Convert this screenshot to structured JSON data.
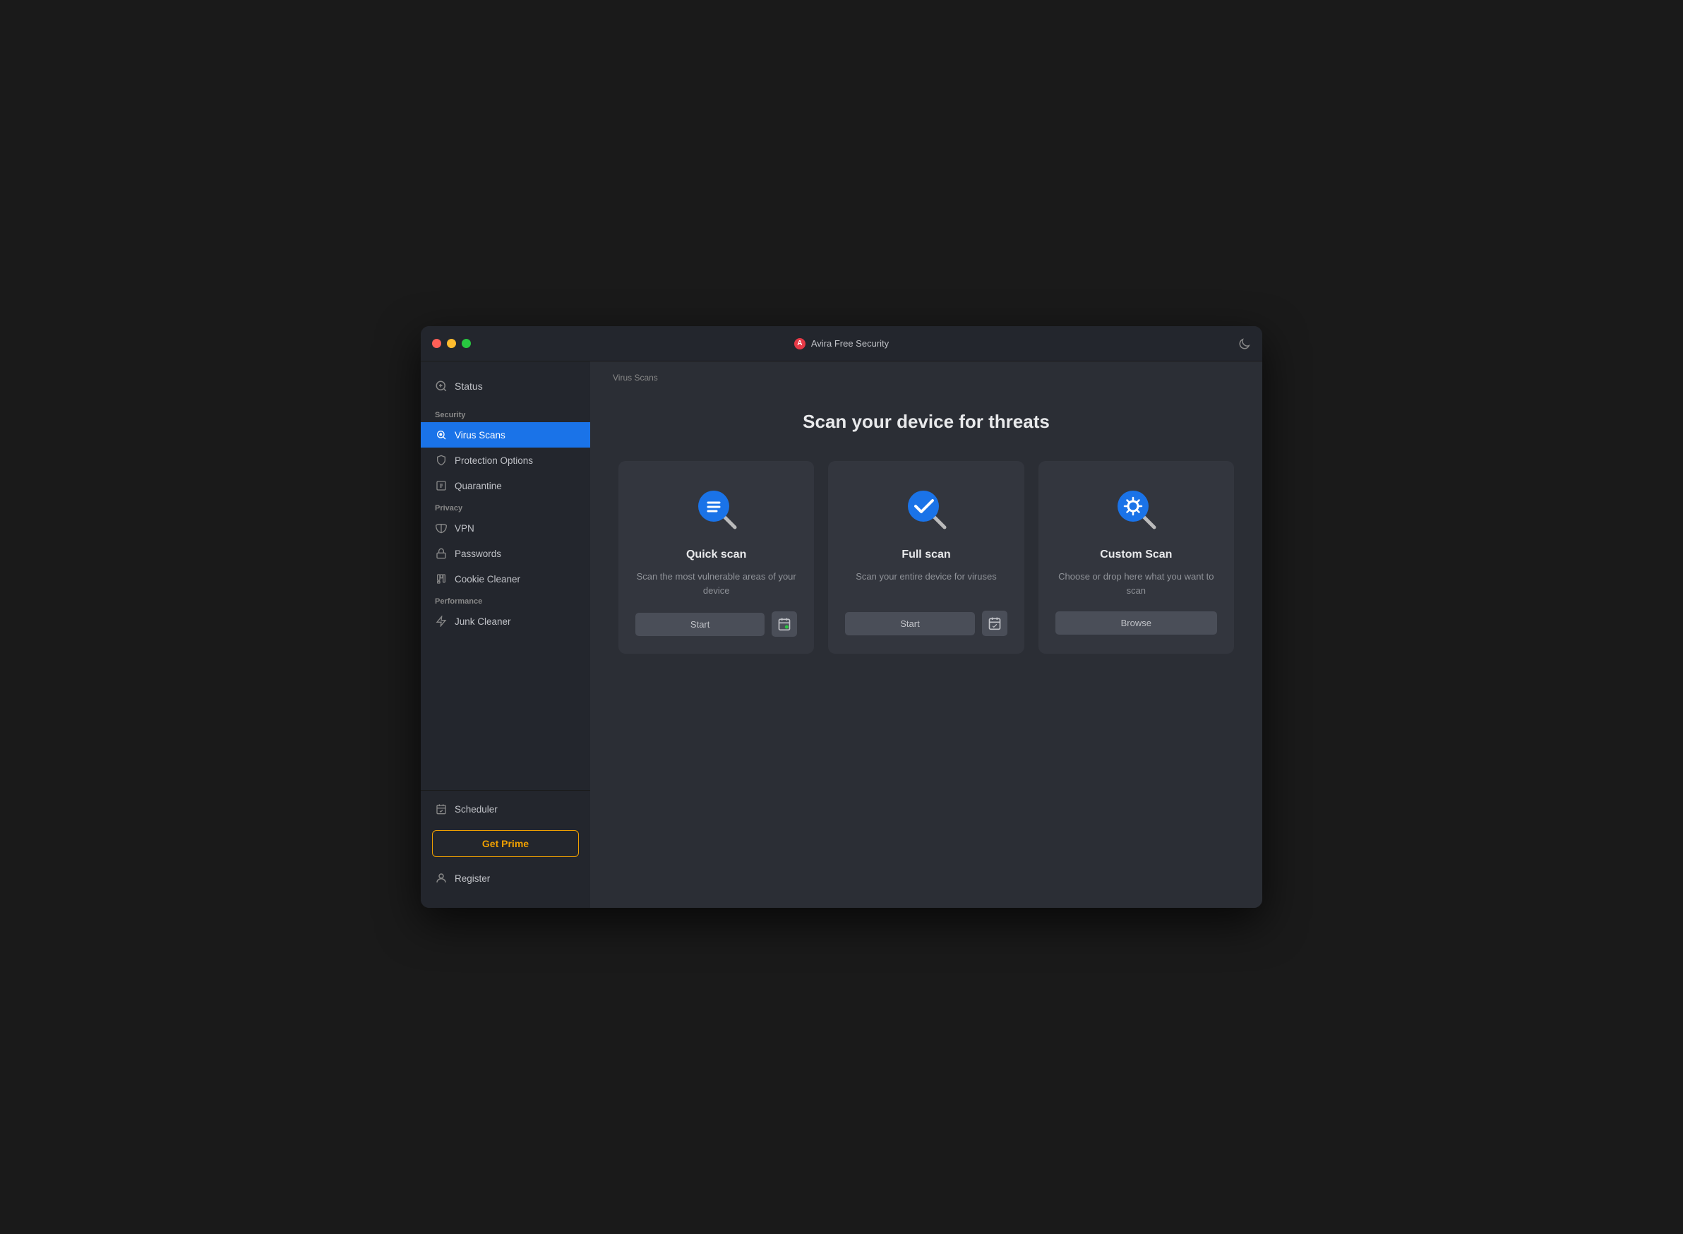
{
  "window": {
    "title": "Avira Free Security"
  },
  "sidebar": {
    "status_label": "Status",
    "sections": [
      {
        "label": "Security",
        "items": [
          {
            "id": "virus-scans",
            "label": "Virus Scans",
            "active": true
          },
          {
            "id": "protection-options",
            "label": "Protection Options",
            "active": false
          },
          {
            "id": "quarantine",
            "label": "Quarantine",
            "active": false
          }
        ]
      },
      {
        "label": "Privacy",
        "items": [
          {
            "id": "vpn",
            "label": "VPN",
            "active": false
          },
          {
            "id": "passwords",
            "label": "Passwords",
            "active": false
          },
          {
            "id": "cookie-cleaner",
            "label": "Cookie Cleaner",
            "active": false
          }
        ]
      },
      {
        "label": "Performance",
        "items": [
          {
            "id": "junk-cleaner",
            "label": "Junk Cleaner",
            "active": false
          }
        ]
      }
    ],
    "scheduler_label": "Scheduler",
    "get_prime_label": "Get Prime",
    "register_label": "Register"
  },
  "main": {
    "breadcrumb": "Virus Scans",
    "title": "Scan your device for threats",
    "cards": [
      {
        "id": "quick-scan",
        "title": "Quick scan",
        "description": "Scan the most vulnerable areas of your device",
        "action_label": "Start",
        "has_schedule": true,
        "has_browse": false
      },
      {
        "id": "full-scan",
        "title": "Full scan",
        "description": "Scan your entire device for viruses",
        "action_label": "Start",
        "has_schedule": true,
        "has_browse": false
      },
      {
        "id": "custom-scan",
        "title": "Custom Scan",
        "description": "Choose or drop here what you want to scan",
        "action_label": "Browse",
        "has_schedule": false,
        "has_browse": true
      }
    ]
  },
  "colors": {
    "active_sidebar": "#1a73e8",
    "accent": "#f0a000",
    "icon_blue": "#1a73e8"
  }
}
